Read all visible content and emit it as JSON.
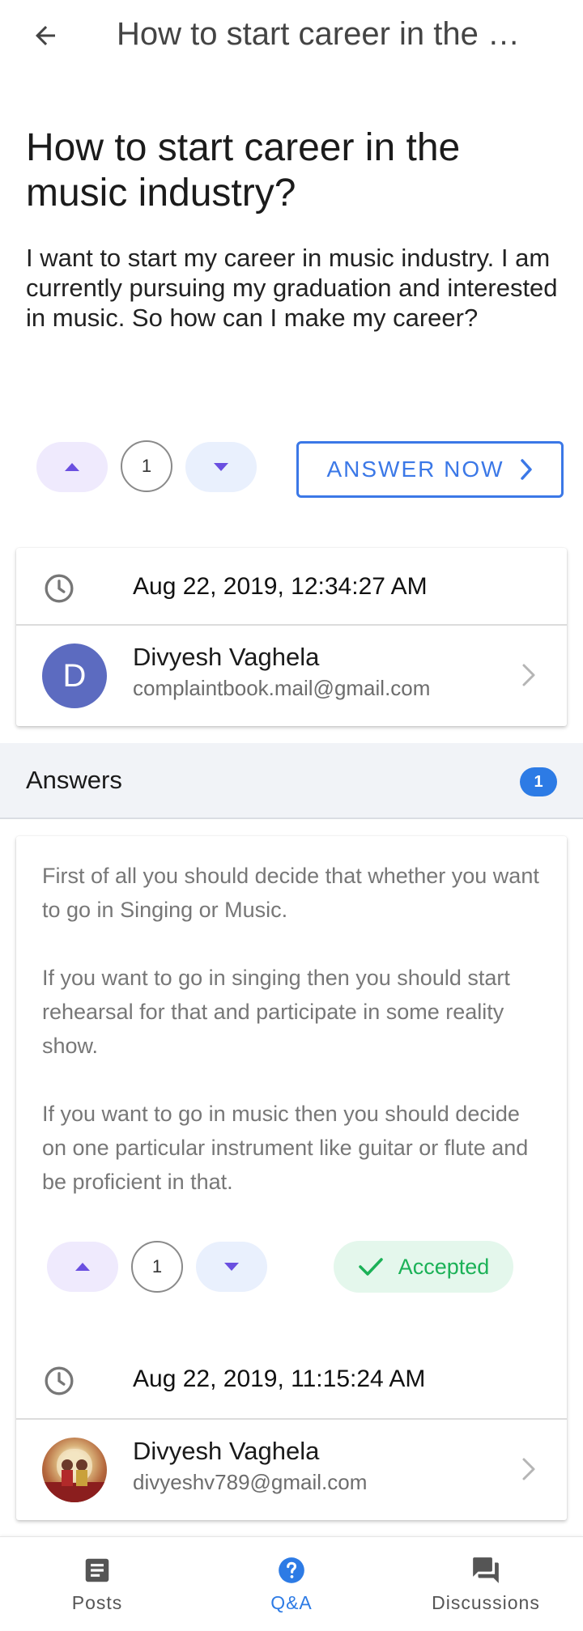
{
  "topbar": {
    "title": "How to start career in the music industry?",
    "back_icon": "arrow-back-icon"
  },
  "question": {
    "title": "How to start career in the music industry?",
    "body": " I want to start my career in music industry. I am currently pursuing my graduation and interested in music. So how can I make my career?",
    "votes": "1"
  },
  "actions": {
    "answer_now": "ANSWER NOW"
  },
  "meta": {
    "date": "Aug 22, 2019, 12:34:27 AM",
    "user_name": "Divyesh Vaghela",
    "user_email": "complaintbook.mail@gmail.com",
    "avatar_letter": "D"
  },
  "answers": {
    "label": "Answers",
    "count": "1",
    "items": [
      {
        "paragraphs": [
          "First of all you should decide that whether you want to go in Singing or Music.",
          "If you want to go in singing then you should start rehearsal for that and participate in some reality show.",
          "If you want to go in music then you should decide on one particular instrument like guitar or flute and be proficient in that."
        ],
        "votes": "1",
        "status": "Accepted",
        "date": "Aug 22, 2019, 11:15:24 AM",
        "user_name": "Divyesh Vaghela",
        "user_email": "divyeshv789@gmail.com"
      }
    ]
  },
  "bottom_nav": {
    "items": [
      {
        "label": "Posts",
        "icon": "article-icon"
      },
      {
        "label": "Q&A",
        "icon": "help-circle-icon"
      },
      {
        "label": "Discussions",
        "icon": "forum-icon"
      }
    ],
    "active": "Q&A"
  },
  "colors": {
    "accent": "#2d7be5",
    "accepted": "#1bb157",
    "vote_arrow": "#6a4fe0",
    "avatar_bg": "#5c6bc0"
  }
}
